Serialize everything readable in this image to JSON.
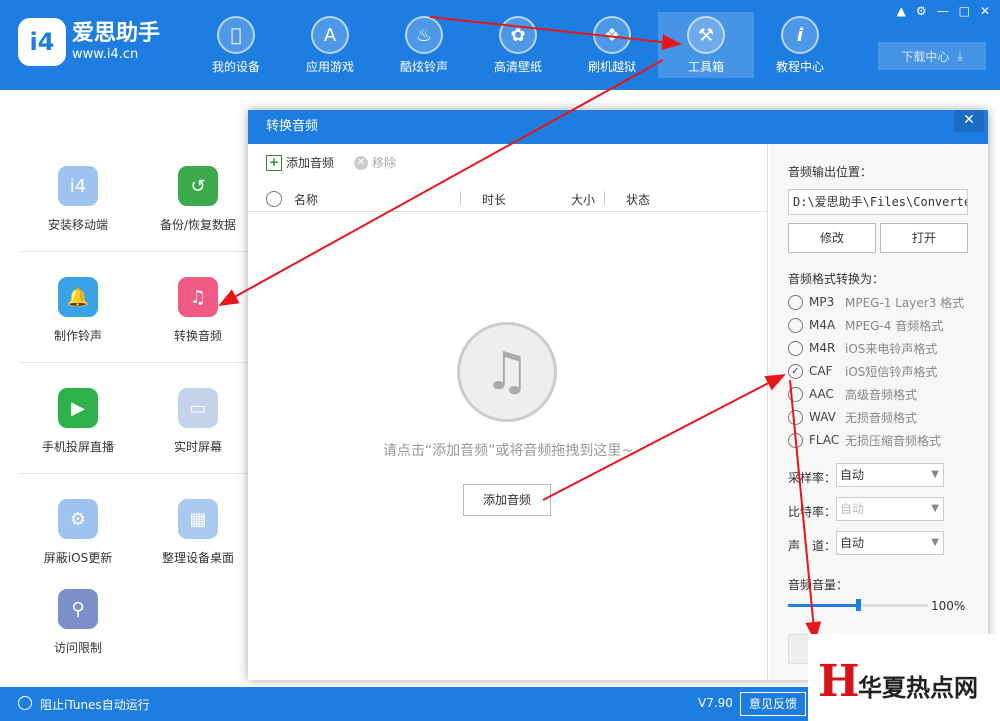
{
  "app": {
    "logo_mark": "i4",
    "name": "爱思助手",
    "url": "www.i4.cn",
    "version": "V7.90",
    "accent_color": "#1d7de0"
  },
  "nav": [
    {
      "label": "我的设备",
      "icon": "apple-icon"
    },
    {
      "label": "应用游戏",
      "icon": "app-store-icon"
    },
    {
      "label": "酷炫铃声",
      "icon": "bell-icon"
    },
    {
      "label": "高清壁纸",
      "icon": "flower-icon"
    },
    {
      "label": "刷机越狱",
      "icon": "dropbox-icon"
    },
    {
      "label": "工具箱",
      "icon": "tools-icon"
    },
    {
      "label": "教程中心",
      "icon": "info-icon"
    }
  ],
  "download_center": "下载中心",
  "tools": [
    {
      "label": "安装移动端",
      "icon": "i4-app-icon",
      "color": "#9fc3ef"
    },
    {
      "label": "备份/恢复数据",
      "icon": "backup-clock-icon",
      "color": "#3caa4a"
    },
    {
      "label": "制作铃声",
      "icon": "bell-plus-icon",
      "color": "#3aa3e8"
    },
    {
      "label": "转换音频",
      "icon": "music-convert-icon",
      "color": "#f05a85"
    },
    {
      "label": "手机投屏直播",
      "icon": "phone-play-icon",
      "color": "#2fb24a"
    },
    {
      "label": "实时屏幕",
      "icon": "monitor-icon",
      "color": "#c5d3ea"
    },
    {
      "label": "屏蔽iOS更新",
      "icon": "gear-shield-icon",
      "color": "#9fc3ef"
    },
    {
      "label": "整理设备桌面",
      "icon": "grid-icon",
      "color": "#a9c9ef"
    },
    {
      "label": "访问限制",
      "icon": "key-icon",
      "color": "#7d8fc8"
    }
  ],
  "dialog": {
    "title": "转换音频",
    "toolbar": {
      "add_label": "添加音频",
      "remove_label": "移除"
    },
    "columns": [
      "名称",
      "时长",
      "大小",
      "状态"
    ],
    "empty_text": "请点击“添加音频”或将音频拖拽到这里~",
    "empty_button": "添加音频",
    "output_label": "音频输出位置：",
    "output_path": "D:\\爱思助手\\Files\\ConvertedAu",
    "modify_button": "修改",
    "open_button": "打开",
    "format_label": "音频格式转换为：",
    "formats": [
      {
        "code": "MP3",
        "desc": "MPEG-1 Layer3 格式",
        "selected": false
      },
      {
        "code": "M4A",
        "desc": "MPEG-4 音频格式",
        "selected": false
      },
      {
        "code": "M4R",
        "desc": "iOS来电铃声格式",
        "selected": false
      },
      {
        "code": "CAF",
        "desc": "iOS短信铃声格式",
        "selected": true
      },
      {
        "code": "AAC",
        "desc": "高级音频格式",
        "selected": false
      },
      {
        "code": "WAV",
        "desc": "无损音频格式",
        "selected": false
      },
      {
        "code": "FLAC",
        "desc": "无损压缩音频格式",
        "selected": false
      }
    ],
    "sample_rate_label": "采样率：",
    "sample_rate_value": "自动",
    "bitrate_label": "比特率：",
    "bitrate_value": "自动",
    "channel_label": "声　道：",
    "channel_value": "自动",
    "volume_label": "音频音量：",
    "volume_value": "100%",
    "volume_fraction": 0.5
  },
  "statusbar": {
    "itunes_label": "阻止iTunes自动运行",
    "feedback": "意见反馈"
  },
  "watermark": {
    "mark": "H",
    "text": "华夏热点网"
  },
  "arrow_color": "#e8161b"
}
